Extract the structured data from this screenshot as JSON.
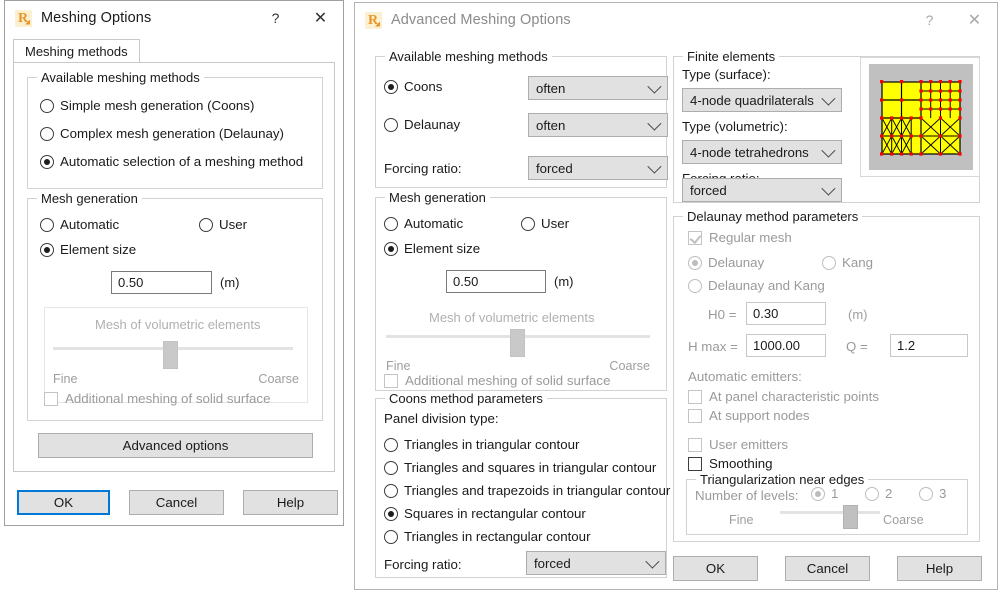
{
  "dialog1": {
    "title": "Meshing Options",
    "icon": "robot-app-icon",
    "help_label": "?",
    "close_label": "✕",
    "tab": {
      "label": "Meshing methods"
    },
    "group_methods": {
      "legend": "Available meshing methods",
      "options": [
        {
          "label": "Simple mesh generation (Coons)",
          "checked": false
        },
        {
          "label": "Complex mesh generation (Delaunay)",
          "checked": false
        },
        {
          "label": "Automatic selection of a meshing method",
          "checked": true
        }
      ]
    },
    "group_generation": {
      "legend": "Mesh generation",
      "automatic": "Automatic",
      "user": "User",
      "element_size": "Element size",
      "size_value": "0.50",
      "size_unit": "(m)",
      "slider_title": "Mesh of volumetric elements",
      "slider_fine": "Fine",
      "slider_coarse": "Coarse",
      "additional_meshing": "Additional meshing of solid surface"
    },
    "advanced_button": "Advanced options",
    "buttons": {
      "ok": "OK",
      "cancel": "Cancel",
      "help": "Help"
    }
  },
  "dialog2": {
    "title": "Advanced Meshing Options",
    "help_label": "?",
    "close_label": "✕",
    "group_methods": {
      "legend": "Available meshing methods",
      "coons_label": "Coons",
      "coons_checked": true,
      "coons_value": "often",
      "delaunay_label": "Delaunay",
      "delaunay_checked": false,
      "delaunay_value": "often",
      "forcing_ratio_label": "Forcing ratio:",
      "forcing_ratio_value": "forced"
    },
    "group_generation": {
      "legend": "Mesh generation",
      "automatic": "Automatic",
      "user": "User",
      "element_size": "Element size",
      "size_value": "0.50",
      "size_unit": "(m)",
      "slider_title": "Mesh of volumetric elements",
      "slider_fine": "Fine",
      "slider_coarse": "Coarse",
      "additional_meshing": "Additional meshing of solid surface"
    },
    "group_coons": {
      "legend": "Coons method parameters",
      "panel_division_label": "Panel division type:",
      "options": [
        {
          "label": "Triangles in triangular contour",
          "checked": false
        },
        {
          "label": "Triangles and squares in triangular contour",
          "checked": false
        },
        {
          "label": "Triangles and trapezoids in triangular contour",
          "checked": false
        },
        {
          "label": "Squares in rectangular contour",
          "checked": true
        },
        {
          "label": "Triangles in rectangular contour",
          "checked": false
        }
      ],
      "forcing_ratio_label": "Forcing ratio:",
      "forcing_ratio_value": "forced"
    },
    "group_finite": {
      "legend": "Finite elements",
      "type_surface_label": "Type (surface):",
      "type_surface_value": "4-node quadrilaterals",
      "type_volumetric_label": "Type (volumetric):",
      "type_volumetric_value": "4-node tetrahedrons",
      "forcing_ratio_label": "Forcing ratio:",
      "forcing_ratio_value": "forced",
      "preview_alt": "mesh-preview-image"
    },
    "group_delaunay": {
      "legend": "Delaunay method parameters",
      "regular_mesh": "Regular mesh",
      "regular_mesh_checked": true,
      "delaunay": "Delaunay",
      "delaunay_checked": true,
      "kang": "Kang",
      "kang_checked": false,
      "delaunay_and_kang": "Delaunay and Kang",
      "delaunay_and_kang_checked": false,
      "h0_label": "H0 =",
      "h0_value": "0.30",
      "h0_unit": "(m)",
      "hmax_label": "H max =",
      "hmax_value": "1000.00",
      "q_label": "Q =",
      "q_value": "1.2",
      "automatic_emitters_label": "Automatic emitters:",
      "at_panel_points": "At panel characteristic points",
      "at_support_nodes": "At support nodes",
      "user_emitters": "User emitters",
      "smoothing": "Smoothing",
      "smoothing_checked": false,
      "triangularization": {
        "legend": "Triangularization near edges",
        "levels_label": "Number of levels:",
        "levels": [
          {
            "label": "1",
            "checked": true
          },
          {
            "label": "2",
            "checked": false
          },
          {
            "label": "3",
            "checked": false
          }
        ],
        "fine": "Fine",
        "coarse": "Coarse"
      }
    },
    "buttons": {
      "ok": "OK",
      "cancel": "Cancel",
      "help": "Help"
    }
  },
  "colors": {
    "accent": "#0078d7",
    "mesh_fill": "#ffff00",
    "mesh_node": "#ff0000",
    "control_bg": "#e1e1e1",
    "disabled_text": "#9a9a9a"
  }
}
